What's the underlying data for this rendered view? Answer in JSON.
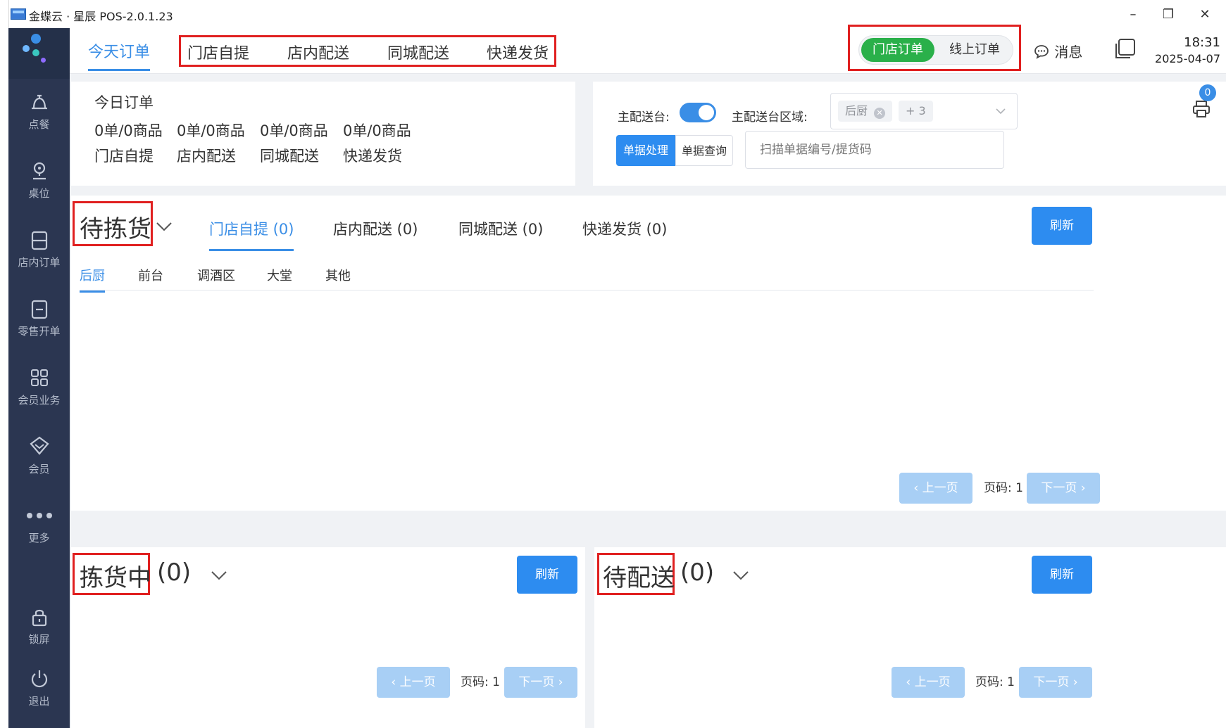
{
  "window": {
    "title": "金蝶云 · 星辰 POS-2.0.1.23",
    "minimize": "–",
    "restore": "❐",
    "close": "✕"
  },
  "sidebar": {
    "items": [
      {
        "label": "点餐",
        "icon": "bell-icon"
      },
      {
        "label": "桌位",
        "icon": "location-icon"
      },
      {
        "label": "店内订单",
        "icon": "receipt-icon"
      },
      {
        "label": "零售开单",
        "icon": "retail-icon"
      },
      {
        "label": "会员业务",
        "icon": "grid-icon"
      },
      {
        "label": "会员",
        "icon": "diamond-icon"
      },
      {
        "label": "更多",
        "icon": "more-icon"
      },
      {
        "label": "锁屏",
        "icon": "lock-icon"
      },
      {
        "label": "退出",
        "icon": "power-icon"
      }
    ]
  },
  "topnav": {
    "today": "今天订单",
    "tabs": [
      "门店自提",
      "店内配送",
      "同城配送",
      "快递发货"
    ],
    "toggle": {
      "active": "门店订单",
      "inactive": "线上订单"
    },
    "message": "消息",
    "time": "18:31",
    "date": "2025-04-07"
  },
  "summary": {
    "title": "今日订单",
    "values": [
      "0单/0商品",
      "0单/0商品",
      "0单/0商品",
      "0单/0商品"
    ],
    "labels": [
      "门店自提",
      "店内配送",
      "同城配送",
      "快递发货"
    ]
  },
  "dispatch": {
    "main_label": "主配送台:",
    "area_label": "主配送台区域:",
    "chip": "后厨",
    "chip_more": "+ 3",
    "seg_active": "单据处理",
    "seg_inactive": "单据查询",
    "scan_placeholder": "扫描单据编号/提货码",
    "print_badge": "0"
  },
  "picking": {
    "title": "待拣货",
    "tabs": [
      "门店自提 (0)",
      "店内配送 (0)",
      "同城配送 (0)",
      "快递发货 (0)"
    ],
    "subtabs": [
      "后厨",
      "前台",
      "调酒区",
      "大堂",
      "其他"
    ],
    "refresh": "刷新",
    "prev": "‹ 上一页",
    "page": "页码: 1",
    "next": "下一页 ›"
  },
  "inprogress": {
    "title": "拣货中",
    "count": "(0)",
    "refresh": "刷新",
    "prev": "‹ 上一页",
    "page": "页码: 1",
    "next": "下一页 ›"
  },
  "todeliver": {
    "title": "待配送",
    "count": "(0)",
    "refresh": "刷新",
    "prev": "‹ 上一页",
    "page": "页码: 1",
    "next": "下一页 ›"
  },
  "colors": {
    "accent": "#3a8ee6",
    "green": "#2ab04a",
    "sidebar": "#2b3651",
    "highlight": "#e02020"
  }
}
